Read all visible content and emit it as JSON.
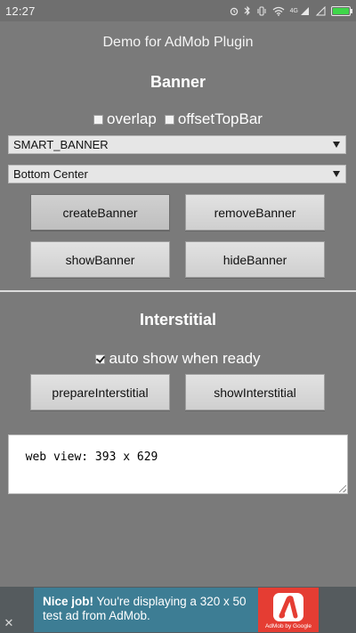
{
  "status_bar": {
    "time": "12:27",
    "network_label": "4G"
  },
  "app": {
    "title": "Demo for AdMob Plugin"
  },
  "banner_section": {
    "heading": "Banner",
    "options": [
      {
        "label": "overlap",
        "checked": false
      },
      {
        "label": "offsetTopBar",
        "checked": false
      }
    ],
    "ad_size_select": {
      "value": "SMART_BANNER"
    },
    "position_select": {
      "value": "Bottom Center"
    },
    "buttons": {
      "create": "createBanner",
      "remove": "removeBanner",
      "show": "showBanner",
      "hide": "hideBanner"
    }
  },
  "interstitial_section": {
    "heading": "Interstitial",
    "auto_show": {
      "label": "auto show when ready",
      "checked": true
    },
    "buttons": {
      "prepare": "prepareInterstitial",
      "show": "showInterstitial"
    }
  },
  "log": {
    "text": "web view: 393 x 629"
  },
  "ad": {
    "headline": "Nice job!",
    "body": "You're displaying a 320 x 50 test ad from AdMob.",
    "badge": "AdMob by Google",
    "close_glyph": "✕",
    "colors": {
      "text_panel": "#3d7d94",
      "logo_panel": "#e53d33"
    }
  }
}
